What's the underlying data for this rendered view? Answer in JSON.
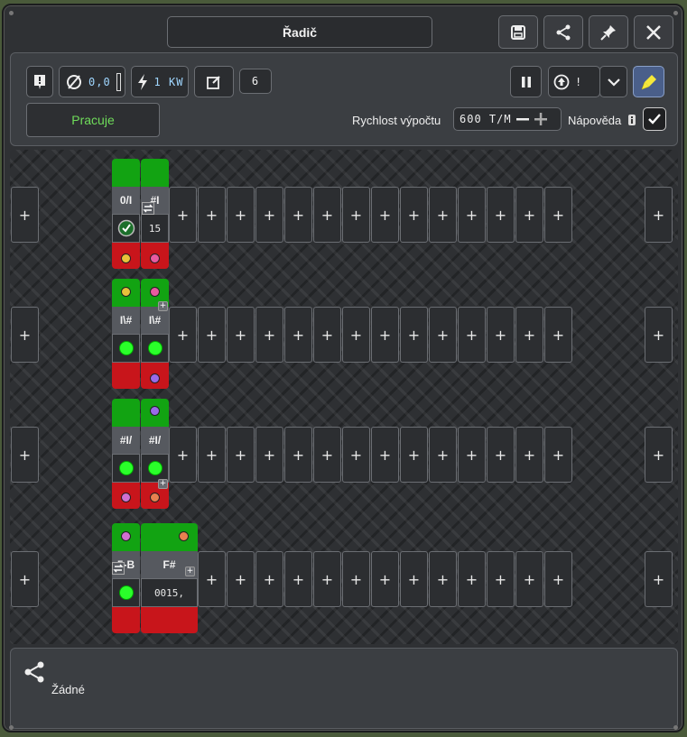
{
  "window": {
    "title": "Řadič"
  },
  "toolbar": {
    "consumption": "0,0",
    "power": "1 KW",
    "edit_value": "6",
    "speed_label": "Rychlost výpočtu",
    "speed_value": "600 T/M",
    "help_label": "Nápověda",
    "help_checked": true,
    "dropdown_value": "!"
  },
  "status": {
    "text": "Pracuje"
  },
  "program": {
    "blocks": [
      {
        "label": "0/I",
        "value": ""
      },
      {
        "label": "#I",
        "value": "15"
      },
      {
        "label": "I\\#",
        "value": ""
      },
      {
        "label": "#I/",
        "value": ""
      },
      {
        "label": "5-B",
        "value": ""
      },
      {
        "label": "F#",
        "value": "0015,"
      }
    ]
  },
  "footer": {
    "label": "Žádné"
  },
  "icons": {
    "save": "save-icon",
    "share": "share-icon",
    "pin": "pin-icon",
    "close": "close-icon",
    "info": "info-icon",
    "null": "null-icon",
    "power": "lightning-icon",
    "edit": "edit-icon",
    "pause": "pause-icon",
    "arrow": "arrow-up-icon",
    "chevron": "chevron-down-icon",
    "paint": "paint-icon"
  },
  "colors": {
    "status_green": "#6fdc5a",
    "block_green": "#12a312",
    "block_red": "#c8151b"
  }
}
